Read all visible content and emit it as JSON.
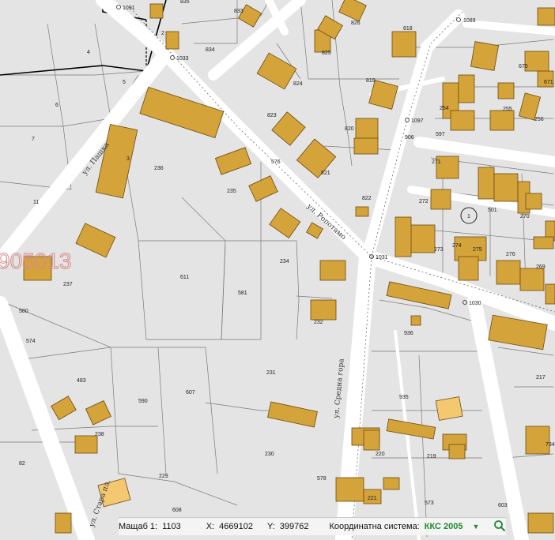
{
  "streets": [
    {
      "id": "pashka",
      "name": "ул. Пашка"
    },
    {
      "id": "ropotamo",
      "name": "ул. Ропотамо"
    },
    {
      "id": "sredna_gora",
      "name": "ул. Средна гора"
    },
    {
      "id": "stara",
      "name": "ул. Стара пл."
    }
  ],
  "cadastral_code": "905013",
  "point_labels": [
    "1091",
    "1033",
    "1089",
    "1097",
    "1031",
    "1030"
  ],
  "parcel_numbers": [
    "835",
    "833",
    "826",
    "818",
    "825",
    "834",
    "824",
    "819",
    "823",
    "820",
    "576",
    "821",
    "822",
    "906",
    "236",
    "235",
    "234",
    "232",
    "611",
    "581",
    "237",
    "580",
    "574",
    "483",
    "590",
    "607",
    "231",
    "936",
    "935",
    "238",
    "82",
    "229",
    "230",
    "608",
    "220",
    "219",
    "578",
    "221",
    "573",
    "603",
    "734",
    "217",
    "670",
    "671",
    "254",
    "255",
    "256",
    "597",
    "271",
    "272",
    "273",
    "274",
    "275",
    "276",
    "269",
    "270",
    "501",
    "1",
    "2",
    "3",
    "4",
    "5",
    "6",
    "7",
    "11"
  ],
  "status": {
    "scale_label": "Мащаб 1:",
    "scale_value": "1103",
    "x_label": "X:",
    "x_value": "4669102",
    "y_label": "Y:",
    "y_value": "399762",
    "crs_label": "Координатна система:",
    "crs_value": "ККС 2005"
  },
  "colors": {
    "background": "#e4e4e4",
    "road": "#ffffff",
    "parcel_line": "#7a7a7a",
    "building_fill": "#d4a339",
    "building_stroke": "#6b4a10",
    "highlight_fill": "#f3c870",
    "cad_code": "#d98a8a",
    "crs_text": "#1f8a2d"
  }
}
